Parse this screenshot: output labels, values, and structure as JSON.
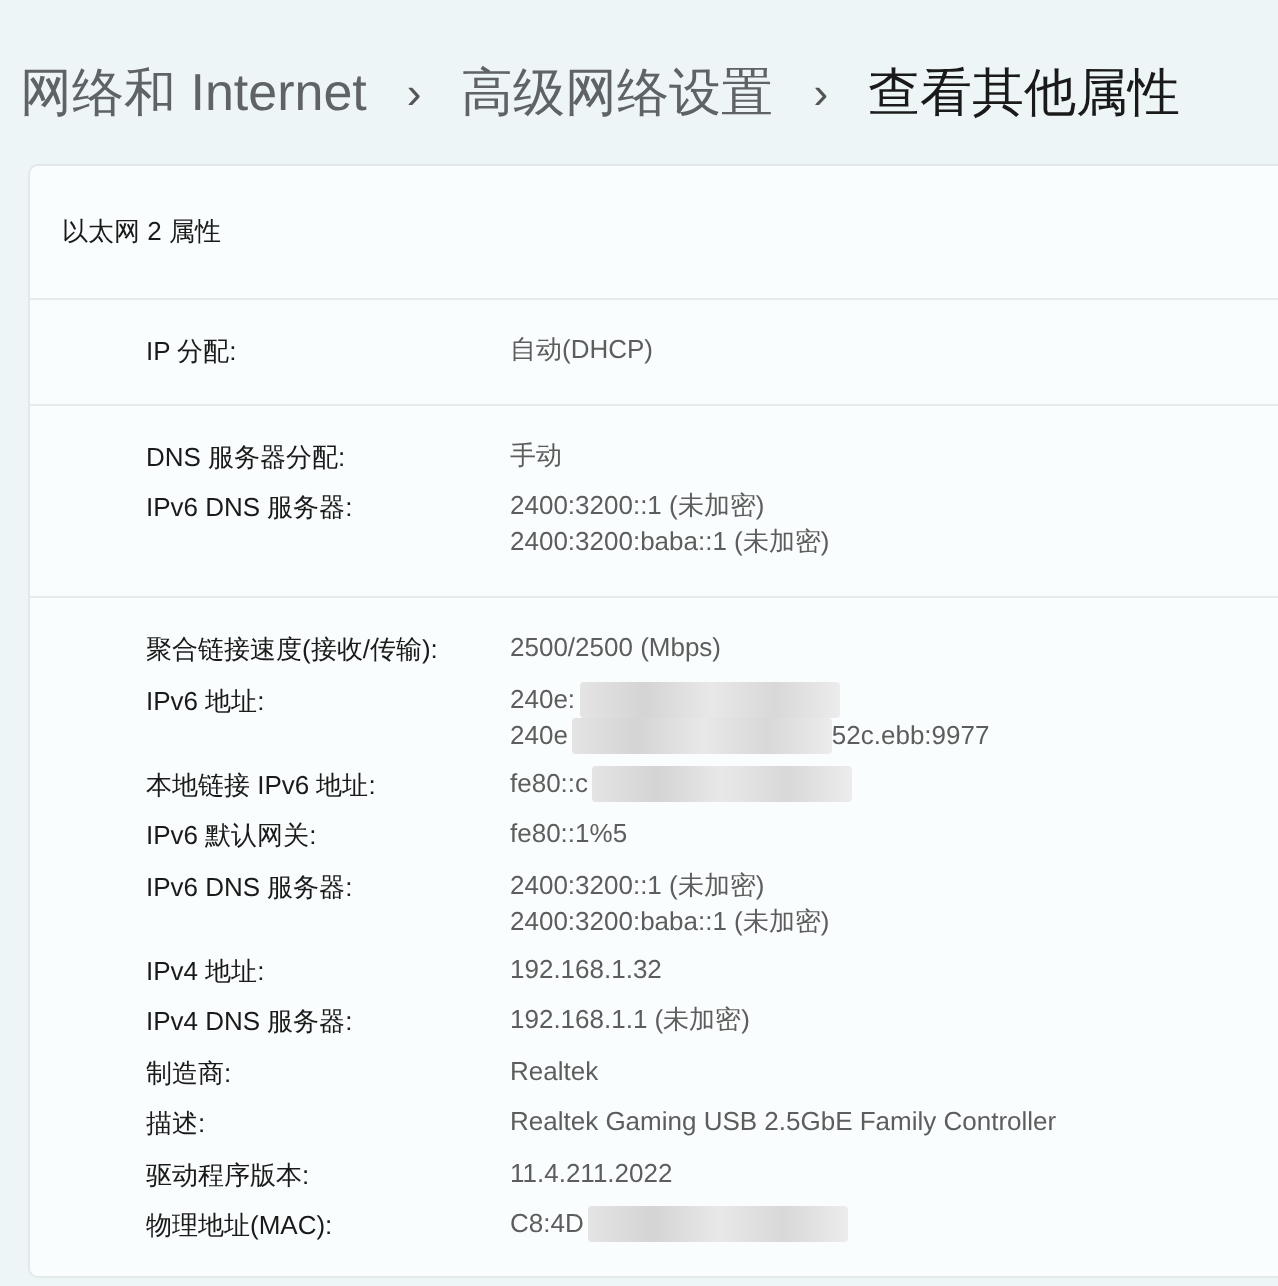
{
  "breadcrumb": [
    {
      "label": "网络和 Internet",
      "current": false
    },
    {
      "label": "高级网络设置",
      "current": false
    },
    {
      "label": "查看其他属性",
      "current": true
    }
  ],
  "breadcrumb_separator": "›",
  "card": {
    "title": "以太网 2 属性",
    "sections": [
      {
        "rows": [
          {
            "label": "IP 分配:",
            "lines": [
              {
                "text": "自动(DHCP)"
              }
            ]
          }
        ]
      },
      {
        "rows": [
          {
            "label": "DNS 服务器分配:",
            "lines": [
              {
                "text": "手动"
              }
            ]
          },
          {
            "label": "IPv6 DNS 服务器:",
            "lines": [
              {
                "text": "2400:3200::1 (未加密)"
              },
              {
                "text": "2400:3200:baba::1 (未加密)"
              }
            ]
          }
        ]
      },
      {
        "rows": [
          {
            "label": "聚合链接速度(接收/传输):",
            "lines": [
              {
                "text": "2500/2500 (Mbps)"
              }
            ]
          },
          {
            "label": "IPv6 地址:",
            "lines": [
              {
                "text": "240e:",
                "blurred": true
              },
              {
                "text": "240e",
                "blurred": true,
                "suffix": "52c.ebb:9977"
              }
            ]
          },
          {
            "label": "本地链接 IPv6 地址:",
            "lines": [
              {
                "text": "fe80::c",
                "blurred": true
              }
            ]
          },
          {
            "label": "IPv6 默认网关:",
            "lines": [
              {
                "text": "fe80::1%5"
              }
            ]
          },
          {
            "label": "IPv6 DNS 服务器:",
            "lines": [
              {
                "text": "2400:3200::1 (未加密)"
              },
              {
                "text": "2400:3200:baba::1 (未加密)"
              }
            ]
          },
          {
            "label": "IPv4 地址:",
            "lines": [
              {
                "text": "192.168.1.32"
              }
            ]
          },
          {
            "label": "IPv4 DNS 服务器:",
            "lines": [
              {
                "text": "192.168.1.1 (未加密)"
              }
            ]
          },
          {
            "label": "制造商:",
            "lines": [
              {
                "text": "Realtek"
              }
            ]
          },
          {
            "label": "描述:",
            "lines": [
              {
                "text": "Realtek Gaming USB 2.5GbE Family Controller"
              }
            ]
          },
          {
            "label": "驱动程序版本:",
            "lines": [
              {
                "text": "11.4.211.2022"
              }
            ]
          },
          {
            "label": "物理地址(MAC):",
            "lines": [
              {
                "text": "C8:4D",
                "blurred": true
              }
            ]
          }
        ]
      }
    ]
  }
}
